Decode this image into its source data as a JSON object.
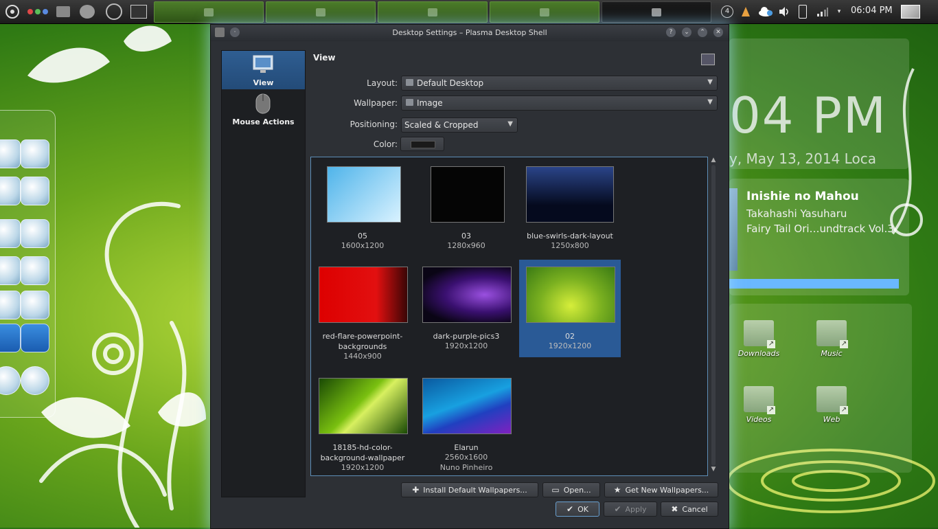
{
  "panel": {
    "clock": "06:04 PM",
    "pager": "4"
  },
  "dialog": {
    "title": "Desktop Settings – Plasma Desktop Shell",
    "nav": [
      {
        "label": "View"
      },
      {
        "label": "Mouse Actions"
      }
    ],
    "page_title": "View",
    "form": {
      "layout_label": "Layout:",
      "layout_value": "Default Desktop",
      "wallpaper_label": "Wallpaper:",
      "wallpaper_value": "Image",
      "positioning_label": "Positioning:",
      "positioning_value": "Scaled & Cropped",
      "color_label": "Color:"
    },
    "wallpapers": [
      {
        "name": "05",
        "size": "1600x1200"
      },
      {
        "name": "03",
        "size": "1280x960"
      },
      {
        "name": "blue-swirls-dark-layout",
        "size": "1250x800"
      },
      {
        "name": "red-flare-powerpoint-backgrounds",
        "size": "1440x900"
      },
      {
        "name": "dark-purple-pics3",
        "size": "1920x1200"
      },
      {
        "name": "02",
        "size": "1920x1200"
      },
      {
        "name": "18185-hd-color-background-wallpaper",
        "size": "1920x1200"
      },
      {
        "name": "Elarun",
        "size": "2560x1600",
        "author": "Nuno Pinheiro"
      }
    ],
    "selected_wallpaper": "02",
    "buttons": {
      "install": "Install Default Wallpapers...",
      "open": "Open...",
      "get_new": "Get New Wallpapers...",
      "ok": "OK",
      "apply": "Apply",
      "cancel": "Cancel"
    }
  },
  "widgets": {
    "clock_time": "04  PM",
    "clock_date": "y, May 13, 2014 Loca",
    "music_title": "Inishie no Mahou",
    "music_artist": "Takahashi Yasuharu",
    "music_album": "Fairy Tail Ori…undtrack Vol.3",
    "music_progress": 0.95,
    "folders": [
      "Downloads",
      "Music",
      "Videos",
      "Web"
    ]
  }
}
